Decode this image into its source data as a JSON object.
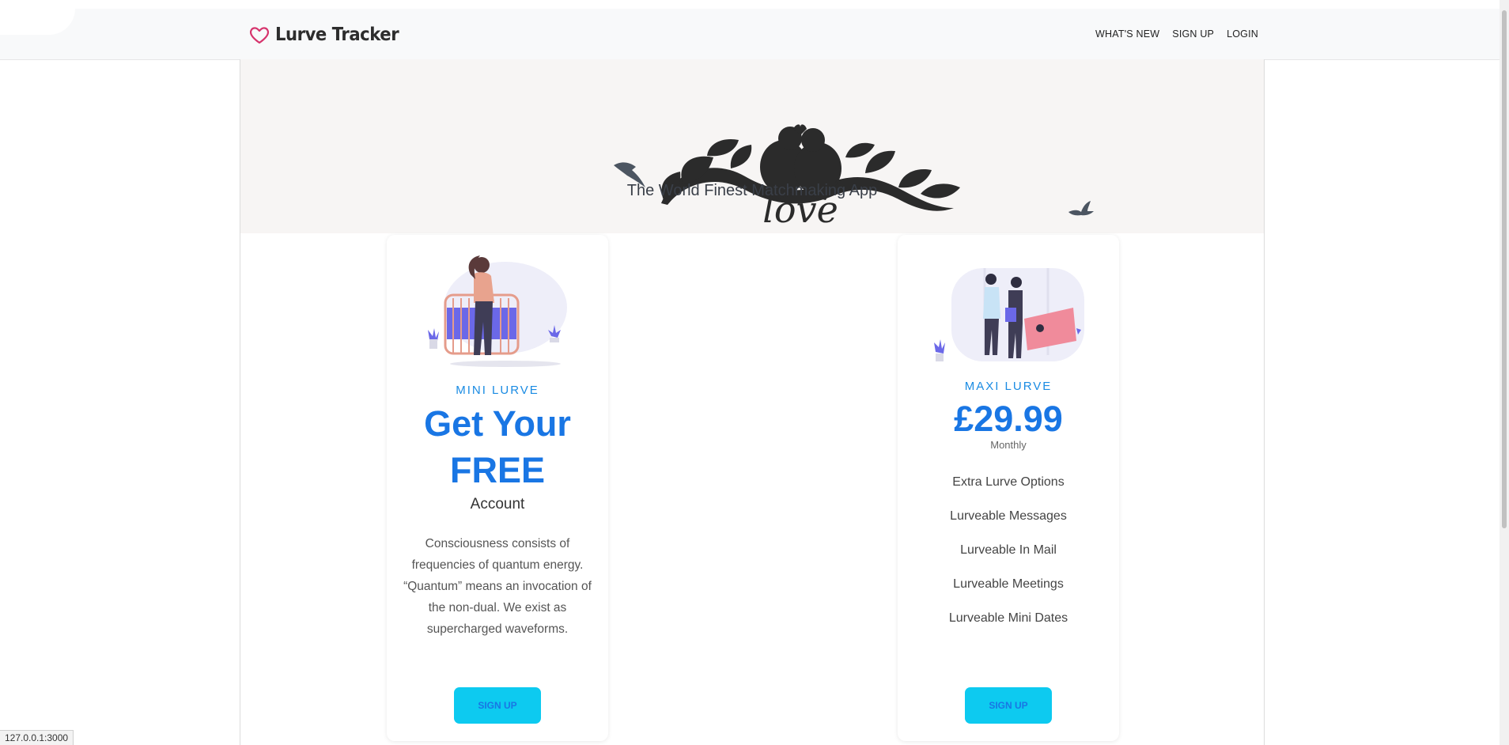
{
  "brand": {
    "name": "Lurve Tracker",
    "icon": "heart-icon",
    "color": "#d6336c"
  },
  "nav": {
    "items": [
      "WHAT'S NEW",
      "SIGN UP",
      "LOGIN"
    ]
  },
  "hero": {
    "tagline": "The World Finest Matchmaking App",
    "art_text": "love"
  },
  "plans": {
    "mini": {
      "tier": "MINI LURVE",
      "headline_1": "Get Your",
      "headline_2": "FREE",
      "subheading": "Account",
      "description": "Consciousness consists of frequencies of quantum energy. “Quantum” means an invocation of the non-dual. We exist as supercharged waveforms.",
      "button": "SIGN UP"
    },
    "maxi": {
      "tier": "MAXI LURVE",
      "price": "£29.99",
      "period": "Monthly",
      "features": [
        "Extra Lurve Options",
        "Lurveable Messages",
        "Lurveable In Mail",
        "Lurveable Meetings",
        "Lurveable Mini Dates"
      ],
      "button": "SIGN UP"
    }
  },
  "status_bar": {
    "url": "127.0.0.1:3000"
  },
  "colors": {
    "accent": "#1976e4",
    "button": "#0dcaf0",
    "hero_bg": "#f7f5f4",
    "navbar_bg": "#f8f9fa"
  }
}
